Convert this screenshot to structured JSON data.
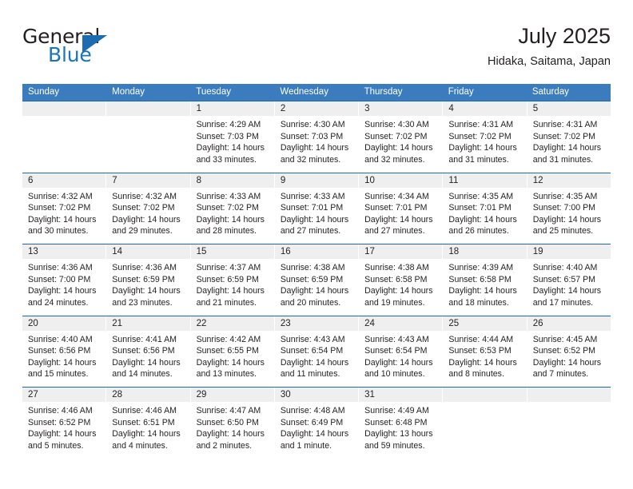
{
  "brand": {
    "word_one": "General",
    "word_two": "Blue",
    "flag_icon": "triangle-flag-icon",
    "color_primary": "#1b6cb0",
    "color_text": "#231f20"
  },
  "header": {
    "title": "July 2025",
    "location": "Hidaka, Saitama, Japan"
  },
  "theme": {
    "header_row_bg": "#3b7cbe",
    "row_divider": "#1b6cb0",
    "daynum_band_bg": "#efeff0",
    "text": "#231f20"
  },
  "weekdays": [
    "Sunday",
    "Monday",
    "Tuesday",
    "Wednesday",
    "Thursday",
    "Friday",
    "Saturday"
  ],
  "weeks": [
    [
      {
        "day": "",
        "lines": [
          "",
          "",
          "",
          ""
        ],
        "empty": true
      },
      {
        "day": "",
        "lines": [
          "",
          "",
          "",
          ""
        ],
        "empty": true
      },
      {
        "day": "1",
        "lines": [
          "Sunrise: 4:29 AM",
          "Sunset: 7:03 PM",
          "Daylight: 14 hours",
          "and 33 minutes."
        ],
        "empty": false
      },
      {
        "day": "2",
        "lines": [
          "Sunrise: 4:30 AM",
          "Sunset: 7:03 PM",
          "Daylight: 14 hours",
          "and 32 minutes."
        ],
        "empty": false
      },
      {
        "day": "3",
        "lines": [
          "Sunrise: 4:30 AM",
          "Sunset: 7:02 PM",
          "Daylight: 14 hours",
          "and 32 minutes."
        ],
        "empty": false
      },
      {
        "day": "4",
        "lines": [
          "Sunrise: 4:31 AM",
          "Sunset: 7:02 PM",
          "Daylight: 14 hours",
          "and 31 minutes."
        ],
        "empty": false
      },
      {
        "day": "5",
        "lines": [
          "Sunrise: 4:31 AM",
          "Sunset: 7:02 PM",
          "Daylight: 14 hours",
          "and 31 minutes."
        ],
        "empty": false
      }
    ],
    [
      {
        "day": "6",
        "lines": [
          "Sunrise: 4:32 AM",
          "Sunset: 7:02 PM",
          "Daylight: 14 hours",
          "and 30 minutes."
        ],
        "empty": false
      },
      {
        "day": "7",
        "lines": [
          "Sunrise: 4:32 AM",
          "Sunset: 7:02 PM",
          "Daylight: 14 hours",
          "and 29 minutes."
        ],
        "empty": false
      },
      {
        "day": "8",
        "lines": [
          "Sunrise: 4:33 AM",
          "Sunset: 7:02 PM",
          "Daylight: 14 hours",
          "and 28 minutes."
        ],
        "empty": false
      },
      {
        "day": "9",
        "lines": [
          "Sunrise: 4:33 AM",
          "Sunset: 7:01 PM",
          "Daylight: 14 hours",
          "and 27 minutes."
        ],
        "empty": false
      },
      {
        "day": "10",
        "lines": [
          "Sunrise: 4:34 AM",
          "Sunset: 7:01 PM",
          "Daylight: 14 hours",
          "and 27 minutes."
        ],
        "empty": false
      },
      {
        "day": "11",
        "lines": [
          "Sunrise: 4:35 AM",
          "Sunset: 7:01 PM",
          "Daylight: 14 hours",
          "and 26 minutes."
        ],
        "empty": false
      },
      {
        "day": "12",
        "lines": [
          "Sunrise: 4:35 AM",
          "Sunset: 7:00 PM",
          "Daylight: 14 hours",
          "and 25 minutes."
        ],
        "empty": false
      }
    ],
    [
      {
        "day": "13",
        "lines": [
          "Sunrise: 4:36 AM",
          "Sunset: 7:00 PM",
          "Daylight: 14 hours",
          "and 24 minutes."
        ],
        "empty": false
      },
      {
        "day": "14",
        "lines": [
          "Sunrise: 4:36 AM",
          "Sunset: 6:59 PM",
          "Daylight: 14 hours",
          "and 23 minutes."
        ],
        "empty": false
      },
      {
        "day": "15",
        "lines": [
          "Sunrise: 4:37 AM",
          "Sunset: 6:59 PM",
          "Daylight: 14 hours",
          "and 21 minutes."
        ],
        "empty": false
      },
      {
        "day": "16",
        "lines": [
          "Sunrise: 4:38 AM",
          "Sunset: 6:59 PM",
          "Daylight: 14 hours",
          "and 20 minutes."
        ],
        "empty": false
      },
      {
        "day": "17",
        "lines": [
          "Sunrise: 4:38 AM",
          "Sunset: 6:58 PM",
          "Daylight: 14 hours",
          "and 19 minutes."
        ],
        "empty": false
      },
      {
        "day": "18",
        "lines": [
          "Sunrise: 4:39 AM",
          "Sunset: 6:58 PM",
          "Daylight: 14 hours",
          "and 18 minutes."
        ],
        "empty": false
      },
      {
        "day": "19",
        "lines": [
          "Sunrise: 4:40 AM",
          "Sunset: 6:57 PM",
          "Daylight: 14 hours",
          "and 17 minutes."
        ],
        "empty": false
      }
    ],
    [
      {
        "day": "20",
        "lines": [
          "Sunrise: 4:40 AM",
          "Sunset: 6:56 PM",
          "Daylight: 14 hours",
          "and 15 minutes."
        ],
        "empty": false
      },
      {
        "day": "21",
        "lines": [
          "Sunrise: 4:41 AM",
          "Sunset: 6:56 PM",
          "Daylight: 14 hours",
          "and 14 minutes."
        ],
        "empty": false
      },
      {
        "day": "22",
        "lines": [
          "Sunrise: 4:42 AM",
          "Sunset: 6:55 PM",
          "Daylight: 14 hours",
          "and 13 minutes."
        ],
        "empty": false
      },
      {
        "day": "23",
        "lines": [
          "Sunrise: 4:43 AM",
          "Sunset: 6:54 PM",
          "Daylight: 14 hours",
          "and 11 minutes."
        ],
        "empty": false
      },
      {
        "day": "24",
        "lines": [
          "Sunrise: 4:43 AM",
          "Sunset: 6:54 PM",
          "Daylight: 14 hours",
          "and 10 minutes."
        ],
        "empty": false
      },
      {
        "day": "25",
        "lines": [
          "Sunrise: 4:44 AM",
          "Sunset: 6:53 PM",
          "Daylight: 14 hours",
          "and 8 minutes."
        ],
        "empty": false
      },
      {
        "day": "26",
        "lines": [
          "Sunrise: 4:45 AM",
          "Sunset: 6:52 PM",
          "Daylight: 14 hours",
          "and 7 minutes."
        ],
        "empty": false
      }
    ],
    [
      {
        "day": "27",
        "lines": [
          "Sunrise: 4:46 AM",
          "Sunset: 6:52 PM",
          "Daylight: 14 hours",
          "and 5 minutes."
        ],
        "empty": false
      },
      {
        "day": "28",
        "lines": [
          "Sunrise: 4:46 AM",
          "Sunset: 6:51 PM",
          "Daylight: 14 hours",
          "and 4 minutes."
        ],
        "empty": false
      },
      {
        "day": "29",
        "lines": [
          "Sunrise: 4:47 AM",
          "Sunset: 6:50 PM",
          "Daylight: 14 hours",
          "and 2 minutes."
        ],
        "empty": false
      },
      {
        "day": "30",
        "lines": [
          "Sunrise: 4:48 AM",
          "Sunset: 6:49 PM",
          "Daylight: 14 hours",
          "and 1 minute."
        ],
        "empty": false
      },
      {
        "day": "31",
        "lines": [
          "Sunrise: 4:49 AM",
          "Sunset: 6:48 PM",
          "Daylight: 13 hours",
          "and 59 minutes."
        ],
        "empty": false
      },
      {
        "day": "",
        "lines": [
          "",
          "",
          "",
          ""
        ],
        "empty": true
      },
      {
        "day": "",
        "lines": [
          "",
          "",
          "",
          ""
        ],
        "empty": true
      }
    ]
  ]
}
